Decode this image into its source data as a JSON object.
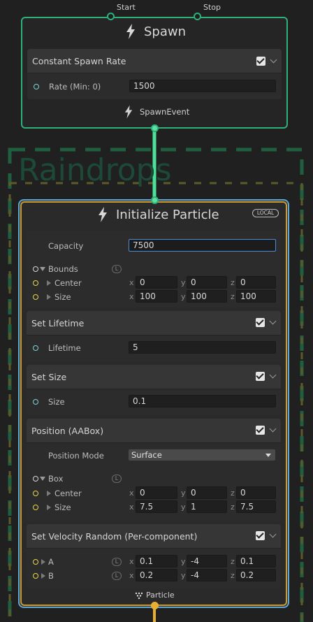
{
  "colors": {
    "spawn_border": "#2fb07a",
    "init_border": "#5aa8d8",
    "particle_flow": "#e8b030",
    "system_dash": "#1f5f3f"
  },
  "spawn": {
    "start_label": "Start",
    "stop_label": "Stop",
    "title": "Spawn",
    "block_title": "Constant Spawn Rate",
    "rate_label": "Rate (Min: 0)",
    "rate_value": "1500",
    "event_label": "SpawnEvent"
  },
  "system_name": "Raindrops",
  "init": {
    "title": "Initialize Particle",
    "space_badge": "LOCAL",
    "capacity_label": "Capacity",
    "capacity_value": "7500",
    "bounds_label": "Bounds",
    "bounds_link": "L",
    "center_label": "Center",
    "center": {
      "x": "0",
      "y": "0",
      "z": "0"
    },
    "size_label": "Size",
    "size": {
      "x": "100",
      "y": "100",
      "z": "100"
    },
    "axes": {
      "x": "x",
      "y": "y",
      "z": "z"
    }
  },
  "lifetime": {
    "title": "Set Lifetime",
    "label": "Lifetime",
    "value": "5"
  },
  "setsize": {
    "title": "Set Size",
    "label": "Size",
    "value": "0.1"
  },
  "position": {
    "title": "Position (AABox)",
    "mode_label": "Position Mode",
    "mode_value": "Surface",
    "box_label": "Box",
    "box_link": "L",
    "center_label": "Center",
    "center": {
      "x": "0",
      "y": "0",
      "z": "0"
    },
    "size_label": "Size",
    "size": {
      "x": "7.5",
      "y": "1",
      "z": "7.5"
    }
  },
  "velocity": {
    "title": "Set Velocity Random (Per-component)",
    "a_label": "A",
    "a_link": "L",
    "a": {
      "x": "0.1",
      "y": "-4",
      "z": "0.1"
    },
    "b_label": "B",
    "b_link": "L",
    "b": {
      "x": "0.2",
      "y": "-4",
      "z": "0.2"
    }
  },
  "particle_output_label": "Particle"
}
